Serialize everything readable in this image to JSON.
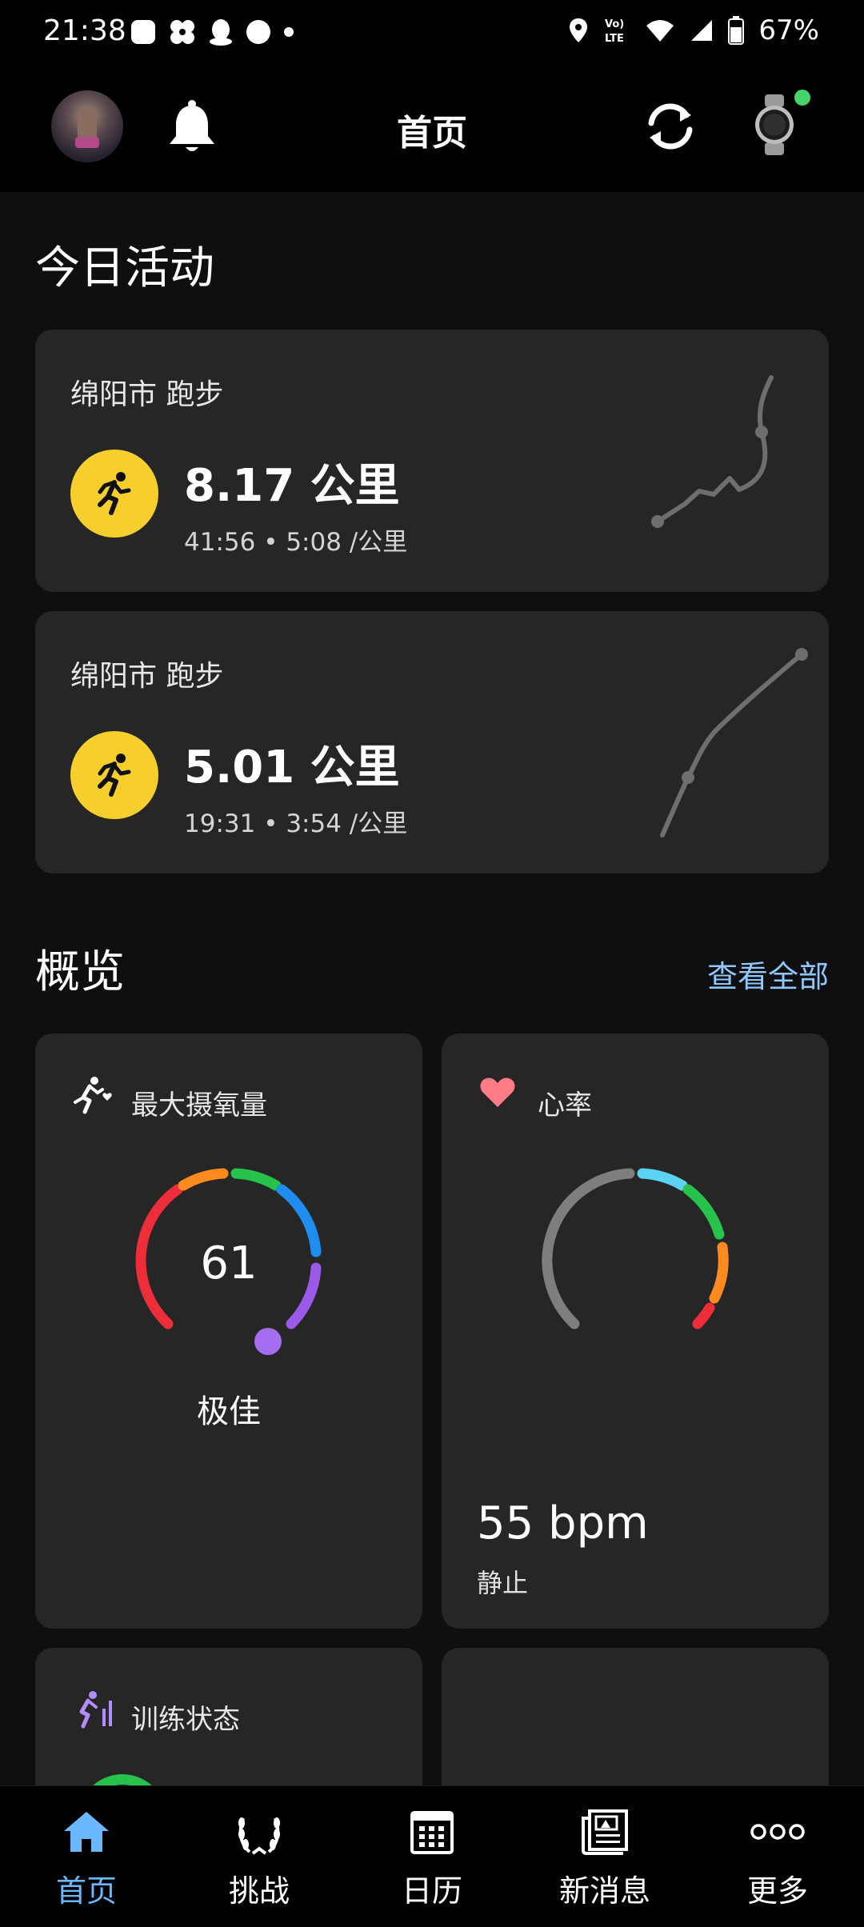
{
  "status_bar": {
    "time": "21:38",
    "battery": "67%",
    "icons": [
      "square-app-icon",
      "pinwheel-icon",
      "qq-icon",
      "circle-icon",
      "dot-icon",
      "location-icon",
      "volte-icon",
      "wifi-icon",
      "signal-icon",
      "battery-icon"
    ]
  },
  "header": {
    "title": "首页",
    "icons": [
      "avatar",
      "bell-icon",
      "sync-icon",
      "watch-icon"
    ],
    "device_status_color": "#46d36b"
  },
  "today": {
    "section_title": "今日活动",
    "activities": [
      {
        "title": "绵阳市 跑步",
        "distance": "8.17 公里",
        "meta": "41:56 • 5:08 /公里",
        "icon": "running-icon"
      },
      {
        "title": "绵阳市 跑步",
        "distance": "5.01 公里",
        "meta": "19:31 • 3:54 /公里",
        "icon": "running-icon"
      }
    ]
  },
  "overview": {
    "section_title": "概览",
    "view_all": "查看全部",
    "vo2max": {
      "title": "最大摄氧量",
      "value": "61",
      "label": "极佳"
    },
    "heart_rate": {
      "title": "心率",
      "value": "55 bpm",
      "label": "静止"
    },
    "training_status": {
      "title": "训练状态"
    }
  },
  "bottom_nav": [
    {
      "label": "首页",
      "icon": "home-icon",
      "active": true
    },
    {
      "label": "挑战",
      "icon": "laurel-icon",
      "active": false
    },
    {
      "label": "日历",
      "icon": "calendar-icon",
      "active": false
    },
    {
      "label": "新消息",
      "icon": "newsfeed-icon",
      "active": false
    },
    {
      "label": "更多",
      "icon": "more-icon",
      "active": false
    }
  ],
  "colors": {
    "accent": "#6ab8ff",
    "link": "#8ec8ff",
    "run_badge": "#f7cf2d",
    "card": "#262626",
    "heart": "#ff7b88"
  }
}
